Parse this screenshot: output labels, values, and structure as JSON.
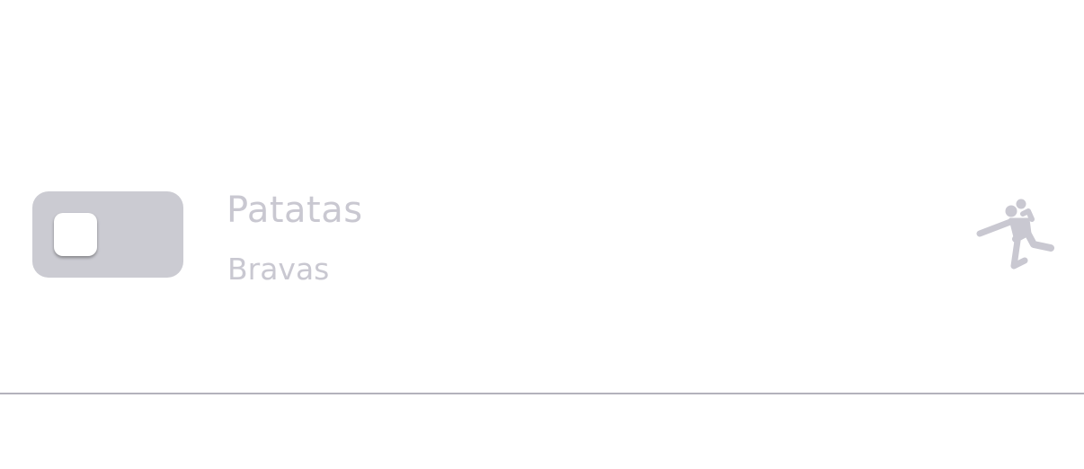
{
  "row": {
    "title": "Patatas",
    "subtitle": "Bravas",
    "toggle_on": false,
    "icon": "handball-player-icon"
  },
  "colors": {
    "toggle_track": "#cbcbd2",
    "text": "#c9c8d1",
    "icon": "#c9c8d1",
    "divider": "#b3b2bc"
  }
}
